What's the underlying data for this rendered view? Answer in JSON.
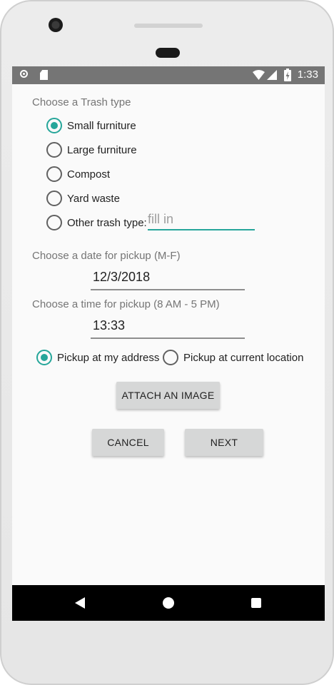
{
  "status_bar": {
    "time": "1:33",
    "icons": [
      "sync-icon",
      "sd-card-icon",
      "wifi-icon",
      "signal-icon",
      "battery-charging-icon"
    ]
  },
  "trash_type": {
    "label": "Choose a Trash type",
    "options": [
      "Small furniture",
      "Large furniture",
      "Compost",
      "Yard waste",
      "Other trash type:"
    ],
    "selected": "Small furniture",
    "other_placeholder": "fill in"
  },
  "date": {
    "label": "Choose a date for pickup (M-F)",
    "value": "12/3/2018"
  },
  "time": {
    "label": "Choose a time for pickup (8 AM - 5 PM)",
    "value": "13:33"
  },
  "pickup_location": {
    "options": [
      "Pickup at my address",
      "Pickup at current location"
    ],
    "selected": "Pickup at my address"
  },
  "buttons": {
    "attach": "ATTACH AN IMAGE",
    "cancel": "CANCEL",
    "next": "NEXT"
  },
  "colors": {
    "accent": "#26a69a",
    "status_bar": "#757575",
    "button": "#d6d7d7",
    "nav_bar": "#000000"
  }
}
